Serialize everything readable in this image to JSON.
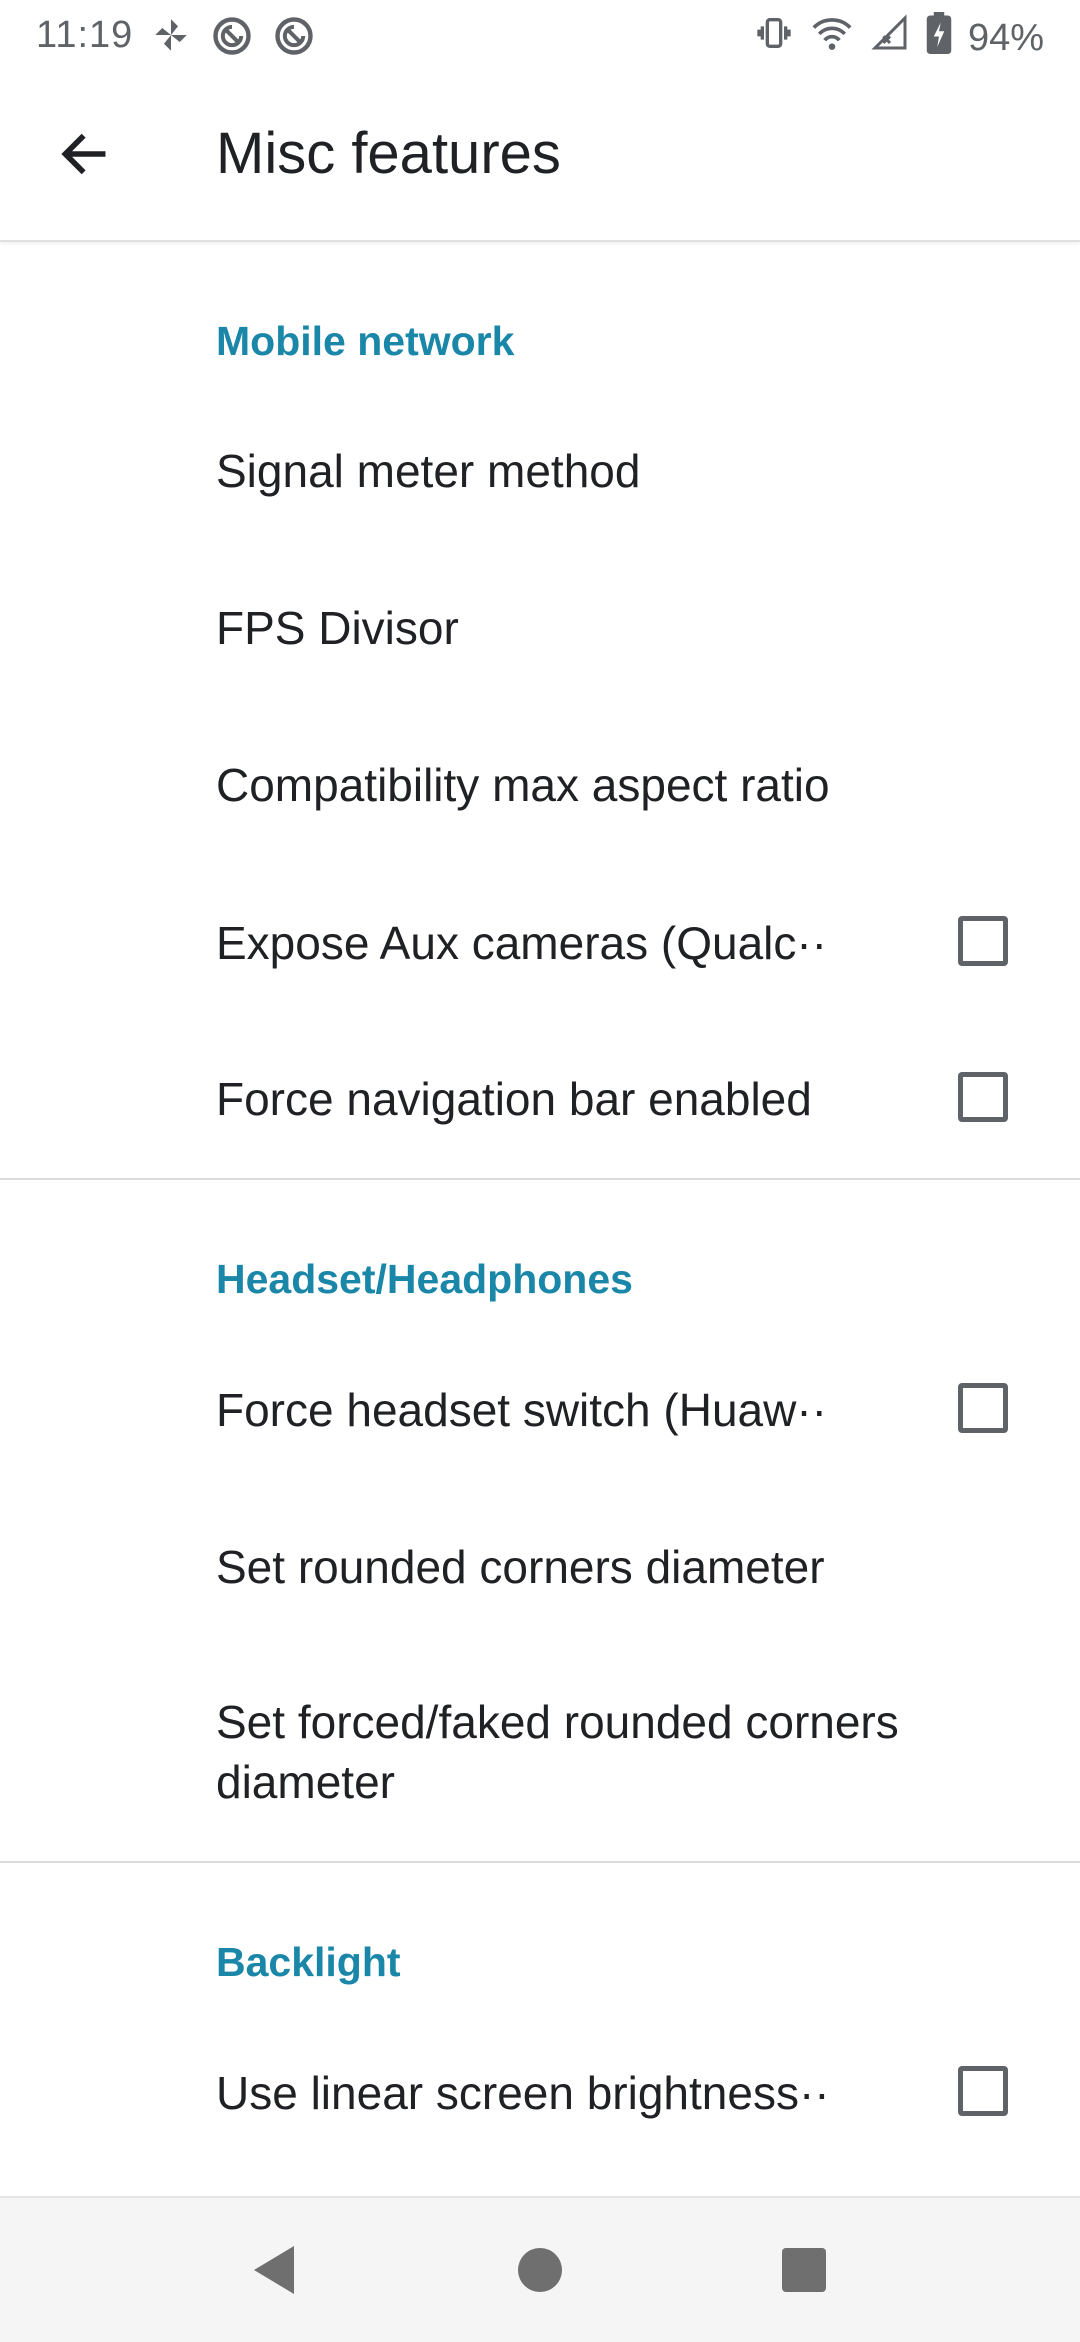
{
  "status_bar": {
    "time": "11:19",
    "battery_percent": "94%",
    "icons_left": [
      "pinwheel-icon",
      "app-notification-icon",
      "app-notification-icon"
    ],
    "icons_right": [
      "vibrate-icon",
      "wifi-icon",
      "cell-signal-icon",
      "battery-charging-icon"
    ]
  },
  "app_bar": {
    "title": "Misc features",
    "back_icon": "arrow-back-icon"
  },
  "sections": [
    {
      "header": "Mobile network",
      "items": [
        {
          "title": "Signal meter method",
          "checkbox": null
        },
        {
          "title": "FPS Divisor",
          "checkbox": null
        },
        {
          "title": "Compatibility max aspect ratio",
          "checkbox": null
        },
        {
          "title": "Expose Aux cameras (Qualc··",
          "checkbox": false
        },
        {
          "title": "Force navigation bar enabled",
          "checkbox": false
        }
      ]
    },
    {
      "header": "Headset/Headphones",
      "items": [
        {
          "title": "Force headset switch (Huaw··",
          "checkbox": false
        },
        {
          "title": "Set rounded corners diameter",
          "checkbox": null
        },
        {
          "title": "Set forced/faked rounded corners diameter",
          "checkbox": null
        }
      ]
    },
    {
      "header": "Backlight",
      "items": [
        {
          "title": "Use linear screen brightness··",
          "checkbox": false
        }
      ]
    }
  ],
  "nav_bar": {
    "icons": [
      "nav-back-icon",
      "nav-home-icon",
      "nav-recents-icon"
    ]
  },
  "colors": {
    "accent": "#1a86a8",
    "text_primary": "#202124",
    "icon_grey": "#5f6368"
  }
}
